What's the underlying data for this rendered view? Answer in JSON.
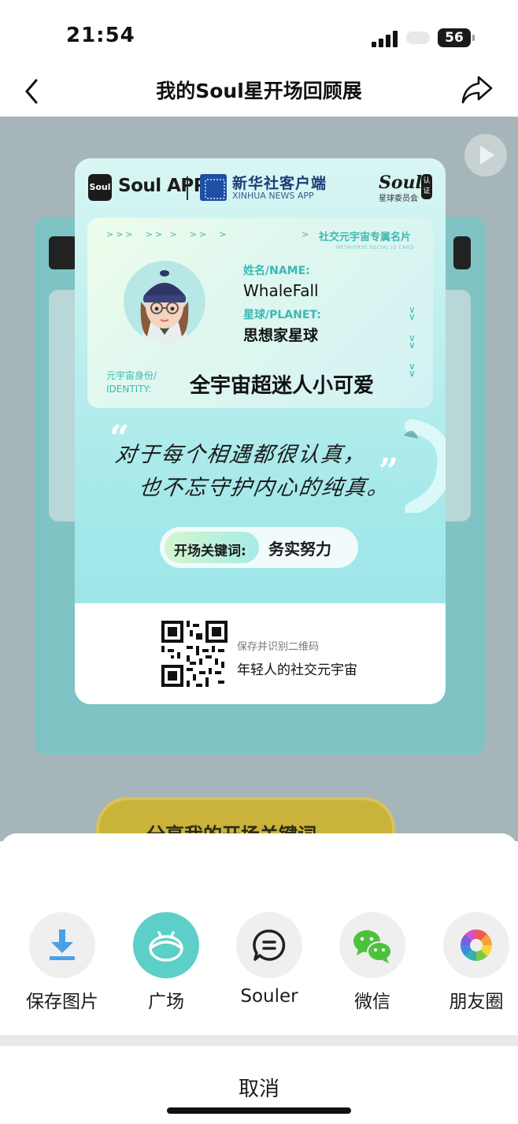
{
  "status_bar": {
    "time": "21:54",
    "battery": "56"
  },
  "nav": {
    "title": "我的Soul星开场回顾展"
  },
  "background": {
    "button_text": "分享我的开场关键词"
  },
  "card": {
    "soul_app": "Soul APP",
    "xinhua_cn": "新华社客户端",
    "xinhua_en": "XINHUA NEWS APP",
    "soul_brand": "Soul",
    "soul_committee": "星球委员会",
    "cert": "认证",
    "card_type": "社交元宇宙专属名片",
    "card_type_en": "METAVERSE SOCIAL ID CARD",
    "name_label": "姓名/NAME:",
    "name_value": "WhaleFall",
    "planet_label": "星球/PLANET:",
    "planet_value": "思想家星球",
    "identity_label_cn": "元宇宙身份/",
    "identity_label_en": "IDENTITY:",
    "identity_value": "全宇宙超迷人小可爱",
    "quote_line1": "对于每个相遇都很认真，",
    "quote_line2": "也不忘守护内心的纯真。",
    "keyword_label": "开场关键词:",
    "keyword_value": "务实努力",
    "qr_hint": "保存并识别二维码",
    "slogan": "年轻人的社交元宇宙"
  },
  "share_sheet": {
    "items": [
      {
        "label": "保存图片",
        "icon": "download-icon"
      },
      {
        "label": "广场",
        "icon": "square-planet-icon"
      },
      {
        "label": "Souler",
        "icon": "chat-bubble-icon"
      },
      {
        "label": "微信",
        "icon": "wechat-icon"
      },
      {
        "label": "朋友圈",
        "icon": "moments-icon"
      }
    ],
    "cancel": "取消"
  },
  "colors": {
    "accent": "#3ab9b3",
    "planet_button": "#5ccfc8",
    "download_blue": "#4aa0e6",
    "wechat_green": "#4cc23c"
  }
}
